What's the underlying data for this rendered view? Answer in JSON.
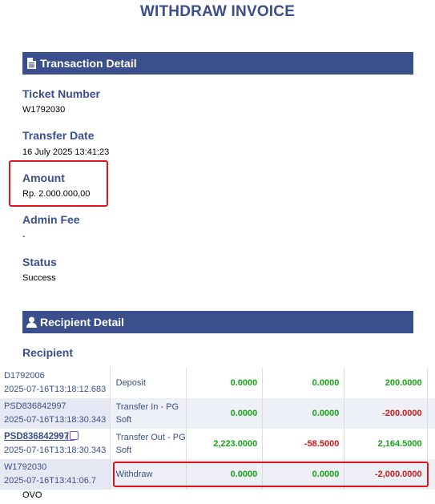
{
  "page_title": "WITHDRAW INVOICE",
  "transaction_section": {
    "heading": "Transaction Detail",
    "fields": [
      {
        "label": "Ticket Number",
        "value": "W1792030"
      },
      {
        "label": "Transfer Date",
        "value": "16 July 2025 13:41:23"
      },
      {
        "label": "Amount",
        "value": "Rp. 2.000.000,00"
      },
      {
        "label": "Admin Fee",
        "value": "-"
      },
      {
        "label": "Status",
        "value": "Success"
      }
    ]
  },
  "recipient_section": {
    "heading": "Recipient Detail",
    "recipient_label": "Recipient",
    "bank_value": "OVO"
  },
  "transactions": [
    {
      "id": "D1792006",
      "datetime": "2025-07-16T13:18:12.683",
      "type": "Deposit",
      "col1": "0.0000",
      "col2": "0.0000",
      "col3": "200.0000"
    },
    {
      "id": "PSD836842997",
      "datetime": "2025-07-16T13:18:30.343",
      "type": "Transfer In - PG Soft",
      "col1": "0.0000",
      "col2": "0.0000",
      "col3": "-200.0000"
    },
    {
      "id": "PSD836842997",
      "datetime": "2025-07-16T13:18:30.343",
      "type": "Transfer Out - PG Soft",
      "col1": "2,223.0000",
      "col2": "-58.5000",
      "col3": "2,164.5000"
    },
    {
      "id": "W1792030",
      "datetime": "2025-07-16T13:41:06.7",
      "type": "Withdraw",
      "col1": "0.0000",
      "col2": "0.0000",
      "col3": "-2,000.0000"
    }
  ],
  "colors": {
    "brand": "#3a4f8c",
    "highlight": "#e0141c",
    "positive": "#16a616",
    "negative": "#d01818"
  },
  "icons": {
    "transaction": "document-icon",
    "recipient": "user-icon",
    "copy": "copy-icon"
  }
}
